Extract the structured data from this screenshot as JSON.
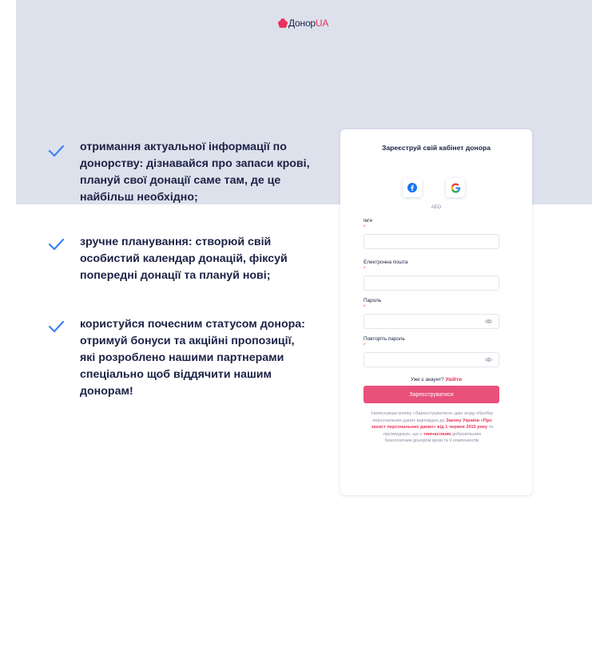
{
  "brand": {
    "name": "Донор",
    "accent": "UA",
    "color": "#e8335a"
  },
  "benefits": [
    {
      "text": "отримання актуальної інформації по донорству: дізнавайся про запаси крові, плануй свої донації саме там, де це найбільш необхідно;"
    },
    {
      "text": "зручне планування: створюй свій особистий календар донацій, фіксуй попередні донації та плануй нові;"
    },
    {
      "text": "користуйся почесним статусом донора: отримуй бонуси та акційні пропозиції, які розроблено нашими партнерами спеціально щоб віддячити нашим донорам!"
    }
  ],
  "form": {
    "title": "Зареєструй свій кабінет донора",
    "social": {
      "facebook": "facebook-icon",
      "google": "google-icon"
    },
    "or": "АБО",
    "required_mark": "*",
    "fields": {
      "name": {
        "label": "Ім'я",
        "value": ""
      },
      "email": {
        "label": "Електронна пошта",
        "value": ""
      },
      "password": {
        "label": "Пароль",
        "value": ""
      },
      "password_repeat": {
        "label": "Повторіть пароль",
        "value": ""
      }
    },
    "login_prompt": "Уже є акаунт?",
    "login_link": "Увійти",
    "submit_label": "Зареєструватися",
    "consent": {
      "before": "Натиснувши кнопку «Зареєструватися» даю згоду обробку персональних даних відповідно до",
      "law_link": "Закону України «Про захист персональних даних» від 1 червня 2010 року",
      "middle": "та підтверджую, що є",
      "status_link": "тимчасовим",
      "after": "добровільним безоплатним донором крові та її компонентів."
    }
  }
}
